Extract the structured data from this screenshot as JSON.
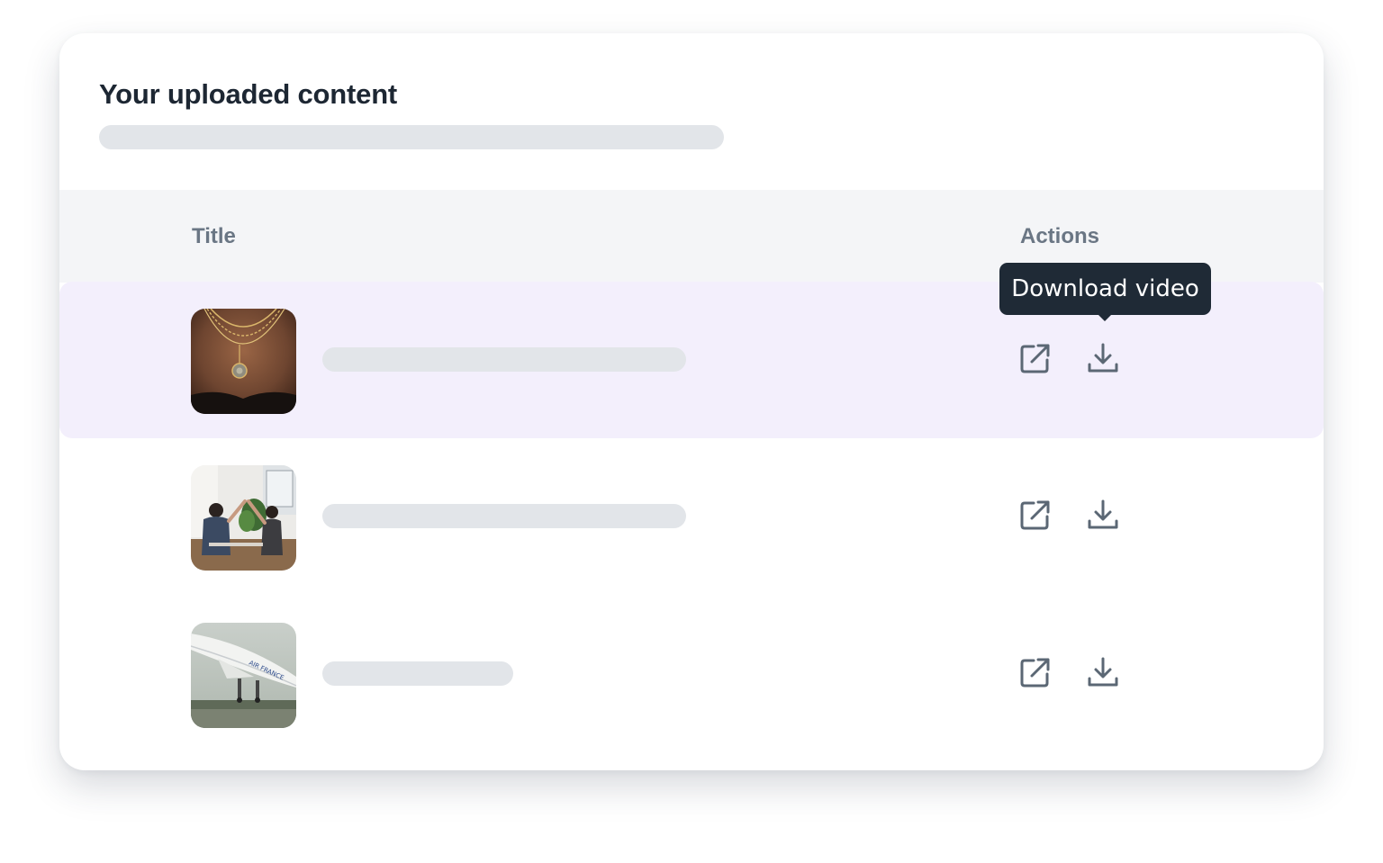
{
  "card": {
    "title": "Your uploaded content"
  },
  "table": {
    "columns": {
      "title": "Title",
      "actions": "Actions"
    },
    "rows": [
      {
        "thumbnail": "necklace-photo",
        "hovered": true,
        "actions": [
          "open-external-icon",
          "download-icon"
        ]
      },
      {
        "thumbnail": "office-high-five-photo",
        "hovered": false,
        "actions": [
          "open-external-icon",
          "download-icon"
        ]
      },
      {
        "thumbnail": "airplane-photo",
        "hovered": false,
        "actions": [
          "open-external-icon",
          "download-icon"
        ]
      }
    ]
  },
  "tooltip": {
    "text": "Download video"
  },
  "colors": {
    "row_hover": "#f3effc",
    "header_bg": "#f4f5f7",
    "skeleton": "#e2e5e9",
    "icon": "#5b6774",
    "tooltip_bg": "#1f2a36",
    "title_text": "#1d2733"
  }
}
